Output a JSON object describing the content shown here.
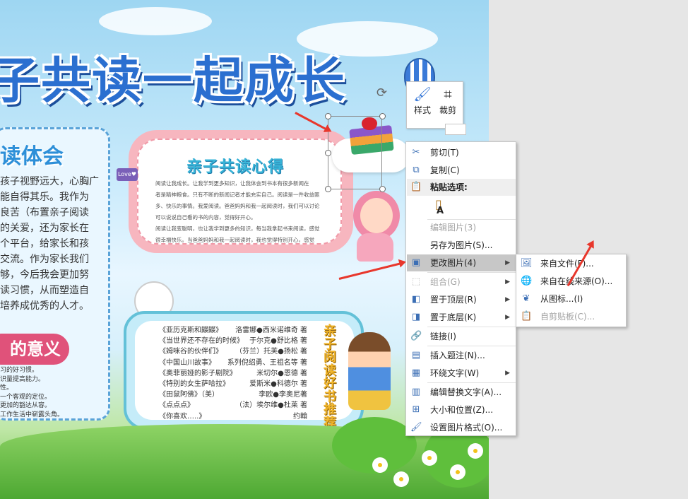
{
  "document": {
    "banner_title": "子共读一起成长",
    "left_panel": {
      "title": "读体会",
      "lines": [
        "孩子视野远大，心胸广",
        "能自得其乐。我作为",
        "良苦（布置亲子阅读",
        "的关爱，还为家长在",
        "个平台，给家长和孩",
        "交流。作为家长我们",
        "够，今后我会更加努",
        "读习惯，从而塑造自",
        "培养成优秀的人才。"
      ],
      "meaning_title": "的意义",
      "meaning_lines": [
        "习的好习惯。",
        "识量提高能力。",
        "性。",
        "一个客观的定位。",
        "更加的豁达从容。",
        "工作生活中崭露头角。"
      ]
    },
    "card1": {
      "tag": "Love♥",
      "title": "亲子共读心得",
      "lines": [
        "阅读让我成长。让我学到更多知识，让我体会到书本有很多新闻在",
        "者是精神粮食。只有不断的新闻记者才能充实自己。阅读是一件收益匪",
        "多、快乐的事情。我爱阅读。爸爸妈妈和我一起阅读时，我们可以讨论",
        "可以说说自己看的书的内容，觉得好开心。",
        "阅读让我变聪明，也让我学到更多的知识，每当我拿起书来阅读，感觉",
        "很幸福快乐。当爸爸妈妈和我一起阅读时，我也觉得特别开心，感觉"
      ]
    },
    "card2": {
      "vertical_title": "亲子阅读好书推荐",
      "books": [
        {
          "title": "《亚历克斯和鼹鼹》",
          "author": "洛雷娜●西米诺维奇 著"
        },
        {
          "title": "《当世界还不存在的时候》",
          "author": "于尔克●舒比格 著"
        },
        {
          "title": "《姆咪谷的伙伴们》",
          "author": "（芬兰）托芙●扬松 著"
        },
        {
          "title": "《中国山川故事》",
          "author": "系列倪绍勇、王祖名等 著"
        },
        {
          "title": "《奥菲丽娅的影子剧院》",
          "author": "米切尔●恩德 著"
        },
        {
          "title": "《特别的女生萨哈拉》",
          "author": "爱斯米●科德尔 著"
        },
        {
          "title": "《田鼠阿佛》（美）",
          "author": "李欧●李奥尼著"
        },
        {
          "title": "《点点点》",
          "author": "（法）埃尔维●杜莱 著"
        },
        {
          "title": "《你喜欢…..》",
          "author": "约翰"
        }
      ]
    }
  },
  "mini_toolbar": {
    "style_label": "样式",
    "crop_label": "裁剪"
  },
  "context_menu": {
    "items": [
      {
        "id": "cut",
        "label": "剪切(T)",
        "icon": "scissors-icon",
        "glyph": "✂",
        "disabled": false
      },
      {
        "id": "copy",
        "label": "复制(C)",
        "icon": "copy-icon",
        "glyph": "⧉",
        "disabled": false
      },
      {
        "id": "paste-header",
        "label": "粘贴选项:",
        "icon": "paste-icon",
        "glyph": "📋",
        "disabled": false
      },
      {
        "id": "edit-picture",
        "label": "编辑图片(3)",
        "disabled": true
      },
      {
        "id": "save-as-picture",
        "label": "另存为图片(S)...",
        "disabled": false
      },
      {
        "id": "change-picture",
        "label": "更改图片(4)",
        "icon": "change-picture-icon",
        "glyph": "▣",
        "disabled": false,
        "submenu": true
      },
      {
        "id": "group",
        "label": "组合(G)",
        "icon": "group-icon",
        "glyph": "⬚",
        "disabled": true,
        "submenu": true
      },
      {
        "id": "bring-to-front",
        "label": "置于顶层(R)",
        "icon": "bring-front-icon",
        "glyph": "◧",
        "disabled": false,
        "submenu": true
      },
      {
        "id": "send-to-back",
        "label": "置于底层(K)",
        "icon": "send-back-icon",
        "glyph": "◨",
        "disabled": false,
        "submenu": true
      },
      {
        "id": "link",
        "label": "链接(I)",
        "icon": "link-icon",
        "glyph": "🔗",
        "disabled": false
      },
      {
        "id": "insert-caption",
        "label": "插入题注(N)...",
        "icon": "caption-icon",
        "glyph": "▤",
        "disabled": false
      },
      {
        "id": "wrap-text",
        "label": "环绕文字(W)",
        "icon": "wrap-text-icon",
        "glyph": "▦",
        "disabled": false,
        "submenu": true
      },
      {
        "id": "edit-alt-text",
        "label": "编辑替换文字(A)...",
        "icon": "alt-text-icon",
        "glyph": "▥",
        "disabled": false
      },
      {
        "id": "size-position",
        "label": "大小和位置(Z)...",
        "icon": "size-position-icon",
        "glyph": "⊞",
        "disabled": false
      },
      {
        "id": "format-picture",
        "label": "设置图片格式(O)...",
        "icon": "format-picture-icon",
        "glyph": "🖌",
        "disabled": false
      }
    ]
  },
  "submenu": {
    "items": [
      {
        "id": "from-file",
        "label": "来自文件(F)...",
        "icon": "from-file-icon",
        "glyph": "🖼",
        "disabled": false
      },
      {
        "id": "from-online",
        "label": "来自在线来源(O)...",
        "icon": "online-source-icon",
        "glyph": "🌐",
        "disabled": false
      },
      {
        "id": "from-icons",
        "label": "从图标...(I)",
        "icon": "icons-icon",
        "glyph": "❦",
        "disabled": false
      },
      {
        "id": "from-clipboard",
        "label": "自剪贴板(C)...",
        "icon": "clipboard-icon",
        "glyph": "📋",
        "disabled": true
      }
    ]
  },
  "colors": {
    "menu_highlight": "#c7c7c7",
    "arrow_red": "#e8372c",
    "title_blue": "#2b6fd0"
  }
}
